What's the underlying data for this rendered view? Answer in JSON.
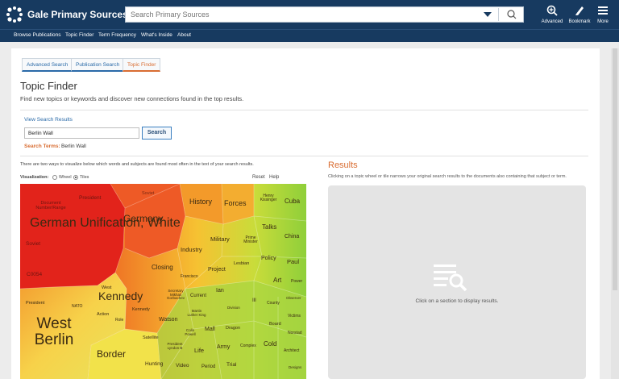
{
  "header": {
    "brand": "Gale Primary Sources",
    "search_placeholder": "Search Primary Sources",
    "tools": {
      "advanced": "Advanced",
      "bookmark": "Bookmark",
      "more": "More"
    }
  },
  "nav": [
    "Browse Publications",
    "Topic Finder",
    "Term Frequency",
    "What's Inside",
    "About"
  ],
  "tabs": [
    "Advanced Search",
    "Publication Search",
    "Topic Finder"
  ],
  "page": {
    "title": "Topic Finder",
    "subtitle": "Find new topics or keywords and discover new connections found in the top results.",
    "view_results": "View Search Results",
    "search_value": "Berlin Wall",
    "search_button": "Search",
    "terms_label": "Search Terms:",
    "terms_value": "Berlin Wall"
  },
  "viz": {
    "intro": "There are two ways to visualize below which words and subjects are found most often in the text of your search results.",
    "label": "Visualization:",
    "opt_wheel": "Wheel",
    "opt_tiles": "Tiles",
    "reset": "Reset",
    "help": "Help",
    "tiles": [
      "German Unification, White",
      "Germany",
      "West Berlin",
      "Kennedy",
      "Border",
      "History",
      "Forces",
      "Cuba",
      "Henry Kissinger",
      "Talks",
      "China",
      "Military",
      "Prime Minister",
      "Industry",
      "Policy",
      "Paul",
      "Closing",
      "Project",
      "Lesbian",
      "Art",
      "Power",
      "Francisco",
      "Ian",
      "Secretary Mikhail Gorbachev",
      "Current",
      "Ill",
      "County",
      "Observer",
      "Watson",
      "Martin Luther King",
      "Division",
      "Victims",
      "Mall",
      "Dragon",
      "Board",
      "Norstad",
      "Satellite",
      "Colin Powell",
      "Army",
      "Cold",
      "Life",
      "Complex",
      "Architect",
      "Hunting",
      "Video",
      "Period",
      "Trial",
      "Designs",
      "Document Number/Range",
      "President",
      "Soviet",
      "Soviet",
      "West",
      "NATO",
      "Action",
      "Role",
      "President",
      "C0054",
      "Kennedy",
      "President Lyndon B"
    ]
  },
  "results": {
    "title": "Results",
    "subtitle": "Clicking on a topic wheel or tile narrows your original search results to the documents also containing that subject or term.",
    "message": "Click on a section to display results."
  }
}
